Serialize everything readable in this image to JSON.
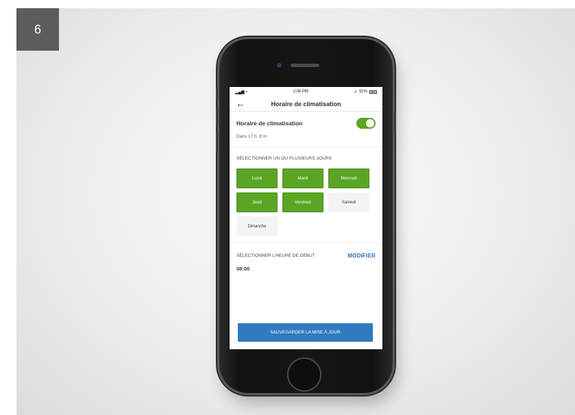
{
  "step": {
    "number": "6"
  },
  "status_bar": {
    "time": "2:06 PM",
    "battery": "92%"
  },
  "header": {
    "title": "Horaire de climatisation"
  },
  "schedule": {
    "toggle_label": "Horaire de climatisation",
    "toggle_on": true,
    "countdown": "Dans 17 h, 8 m"
  },
  "days": {
    "heading": "SÉLECTIONNER UN OU PLUSIEURS JOURS",
    "items": [
      {
        "label": "Lundi",
        "selected": true
      },
      {
        "label": "Mardi",
        "selected": true
      },
      {
        "label": "Mercredi",
        "selected": true
      },
      {
        "label": "Jeudi",
        "selected": true
      },
      {
        "label": "Vendredi",
        "selected": true
      },
      {
        "label": "Samedi",
        "selected": false
      },
      {
        "label": "Dimanche",
        "selected": false
      }
    ]
  },
  "start_time": {
    "heading": "SÉLECTIONNER L'HEURE DE DÉBUT",
    "modify_label": "MODIFIER",
    "value": "08:00"
  },
  "save_button": {
    "label": "SAUVEGARDER LA MISE À JOUR"
  },
  "colors": {
    "accent_green": "#5ba524",
    "accent_blue": "#2f7bbd",
    "link_blue": "#2c6fb3"
  }
}
